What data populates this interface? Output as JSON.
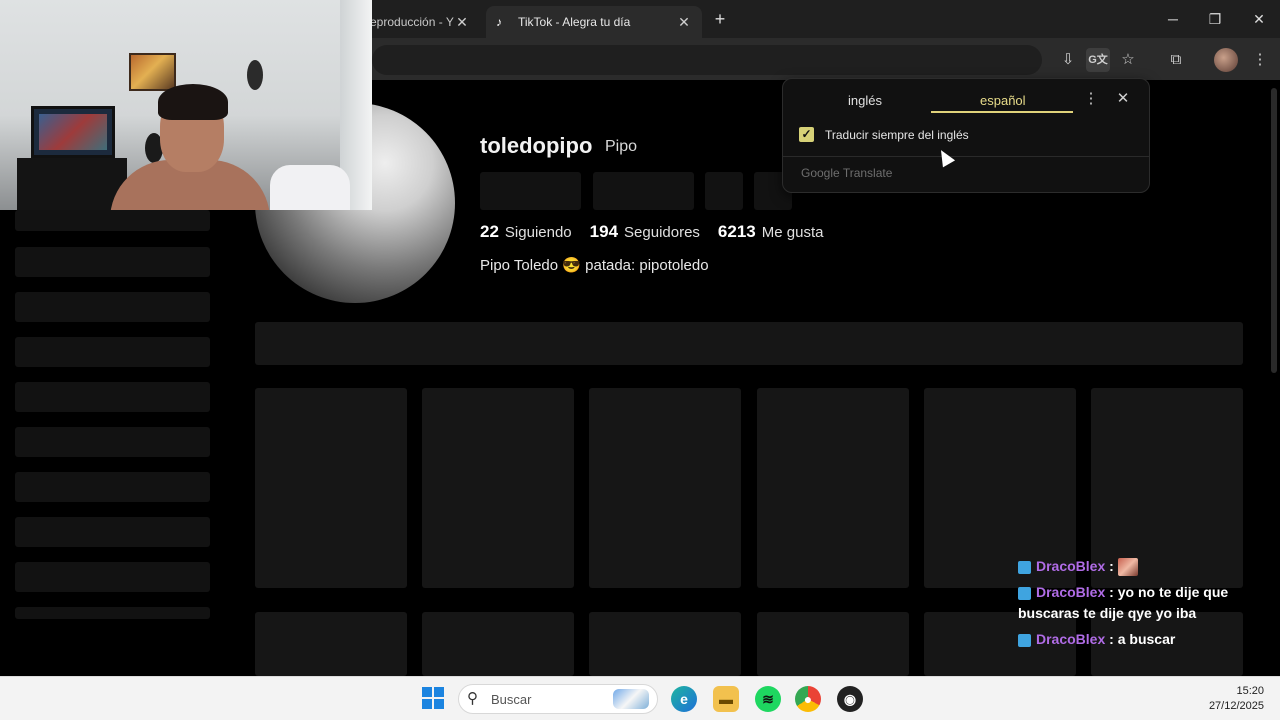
{
  "browser": {
    "tabs": [
      {
        "label": "eproducción - Y",
        "active": false
      },
      {
        "label": "TikTok - Alegra tu día",
        "active": true
      }
    ],
    "new_tab": "+",
    "window_controls": {
      "minimize": "─",
      "restore": "❐",
      "close": "✕"
    }
  },
  "translate_popup": {
    "source_lang": "inglés",
    "target_lang": "español",
    "always_translate_label": "Traducir siempre del inglés",
    "always_translate_checked": true,
    "footer_google": "Google",
    "footer_translate": "Translate"
  },
  "profile": {
    "username": "toledopipo",
    "nickname": "Pipo",
    "stats": {
      "following_count": "22",
      "following_label": "Siguiendo",
      "followers_count": "194",
      "followers_label": "Seguidores",
      "likes_count": "6213",
      "likes_label": "Me gusta"
    },
    "bio": "Pipo Toledo 😎 patada: pipotoledo"
  },
  "chat": [
    {
      "user": "DracoBlex",
      "sep": " : ",
      "message": "",
      "emote": true
    },
    {
      "user": "DracoBlex",
      "sep": " : ",
      "message": "yo no te dije que buscaras te dije qye yo iba",
      "emote": false
    },
    {
      "user": "DracoBlex",
      "sep": " : ",
      "message": "a buscar",
      "emote": false
    }
  ],
  "taskbar": {
    "search_placeholder": "Buscar",
    "time": "15:20",
    "date": "27/12/2025"
  },
  "colors": {
    "accent_lang": "#e8dc8a",
    "chat_user": "#b06ce6",
    "windows_blue": "#1b84e0"
  }
}
